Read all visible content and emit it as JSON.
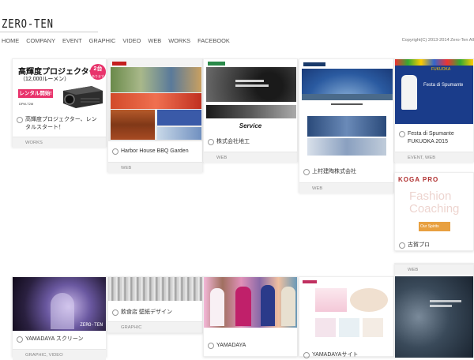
{
  "site": {
    "logo": "ZERO-TEN",
    "copyright": "Copyright(C) 2013-2014 Zero-Ten All"
  },
  "nav": [
    "HOME",
    "COMPANY",
    "EVENT",
    "GRAPHIC",
    "VIDEO",
    "WEB",
    "WORKS",
    "FACEBOOK"
  ],
  "cards": {
    "projector": {
      "title": "高輝度プロジェクター、レンタルスタート！",
      "tag": "WORKS",
      "ad_heading": "高輝度プロジェクター",
      "ad_sub": "（12,000ルーメン）",
      "ad_badge": "2台",
      "ad_badge_sub": "あります",
      "ad_ribbon": "レンタル開始!",
      "ad_model": "DPM-T2M"
    },
    "harbor": {
      "title": "Harbor House BBQ Garden",
      "tag": "WEB"
    },
    "chiko": {
      "title": "株式会社地工",
      "tag": "WEB",
      "shot_text": "Service"
    },
    "kamimura": {
      "title": "上村建陶株式会社",
      "tag": "WEB"
    },
    "festa": {
      "title": "Festa di Spumante FUKUOKA 2015",
      "tag": "EVENT, WEB",
      "poster_text": "Festa di Spumante",
      "poster_sub": "FUKUOKA"
    },
    "koga": {
      "title": "古賀プロ",
      "brand": "KOGA PRO",
      "spirits": "Our Spirits",
      "overlay": "Fashion Coaching"
    },
    "yamadaya_screen": {
      "title": "YAMADAYA スクリーン",
      "tag": "GRAPHIC, VIDEO",
      "watermark": "ZERO-TEN"
    },
    "wallpaper": {
      "title": "飲食店 壁紙デザイン",
      "tag": "GRAPHIC"
    },
    "yamadaya": {
      "title": "YAMADAYA"
    },
    "yamadaya_site": {
      "title": "YAMADAYAサイト"
    },
    "web_partial": {
      "tag": "WEB"
    }
  }
}
